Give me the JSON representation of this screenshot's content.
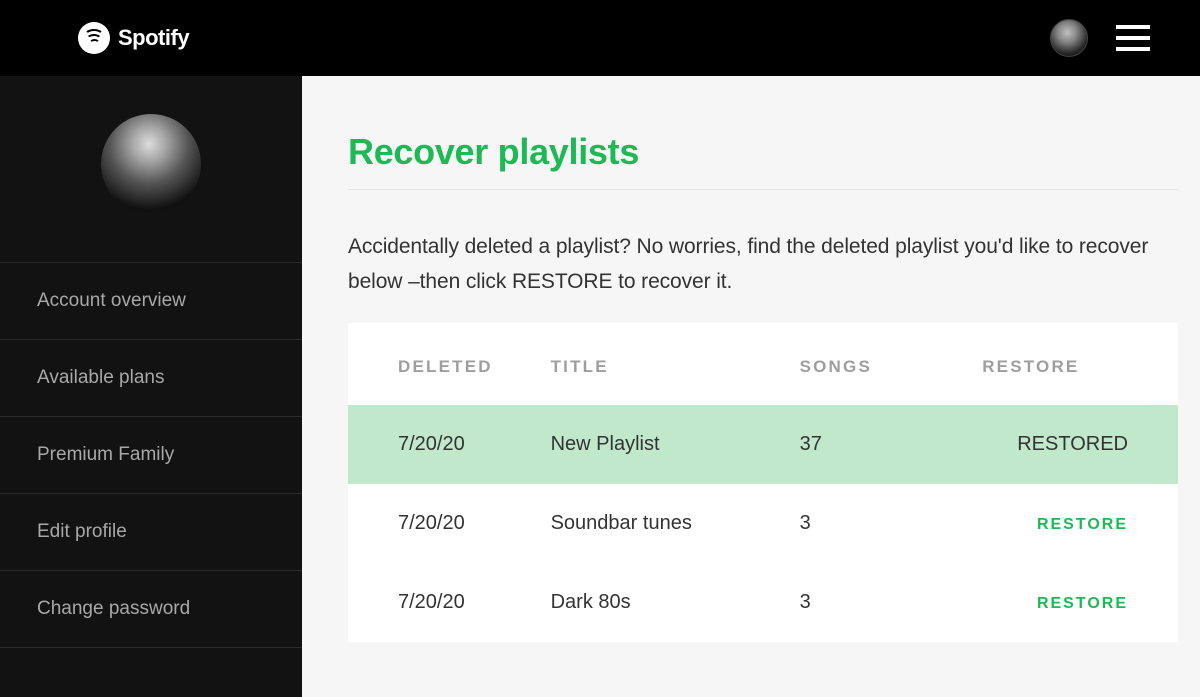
{
  "brand": "Spotify",
  "sidebar": {
    "items": [
      {
        "label": "Account overview"
      },
      {
        "label": "Available plans"
      },
      {
        "label": "Premium Family"
      },
      {
        "label": "Edit profile"
      },
      {
        "label": "Change password"
      }
    ]
  },
  "page": {
    "title": "Recover playlists",
    "description": "Accidentally deleted a playlist? No worries, find the deleted playlist you'd like to recover below –then click RESTORE to recover it."
  },
  "table": {
    "headers": {
      "deleted": "DELETED",
      "title": "TITLE",
      "songs": "SONGS",
      "restore": "RESTORE"
    },
    "rows": [
      {
        "deleted": "7/20/20",
        "title": "New Playlist",
        "songs": "37",
        "action": "RESTORED",
        "restored": true
      },
      {
        "deleted": "7/20/20",
        "title": "Soundbar tunes",
        "songs": "3",
        "action": "RESTORE",
        "restored": false
      },
      {
        "deleted": "7/20/20",
        "title": "Dark 80s",
        "songs": "3",
        "action": "RESTORE",
        "restored": false
      }
    ]
  }
}
